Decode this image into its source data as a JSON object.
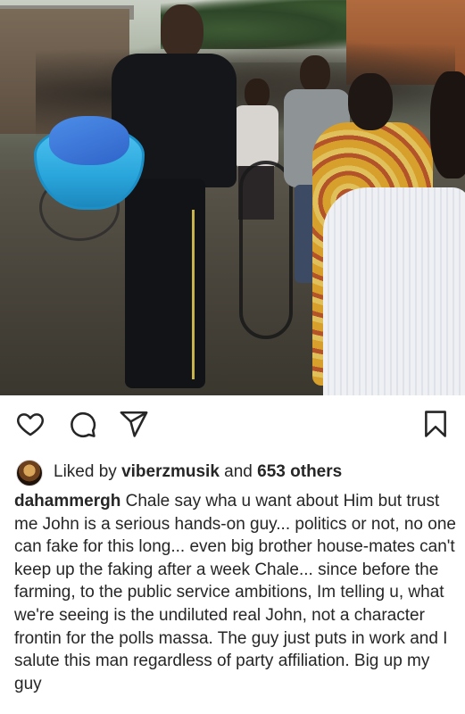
{
  "post": {
    "photo_alt": "",
    "actions": {
      "like_icon": "heart-icon",
      "comment_icon": "comment-icon",
      "share_icon": "send-icon",
      "save_icon": "bookmark-icon"
    },
    "likes": {
      "prefix": "Liked by",
      "liked_by_user": "viberzmusik",
      "connector": "and",
      "others": "653 others"
    },
    "caption": {
      "username": "dahammergh",
      "text": "Chale say wha u want about Him but trust me John is a serious hands-on guy... politics or not, no one can fake for this long... even big brother house-mates can't keep up the faking after a week Chale... since before the farming, to the public service ambitions, Im telling u, what we're seeing is the undiluted real John, not a character frontin for the polls massa. The guy just puts in work and I salute this man regardless of party affiliation. Big up my guy"
    }
  },
  "colors": {
    "text": "#262626",
    "background": "#ffffff",
    "icon_stroke": "#262626"
  }
}
